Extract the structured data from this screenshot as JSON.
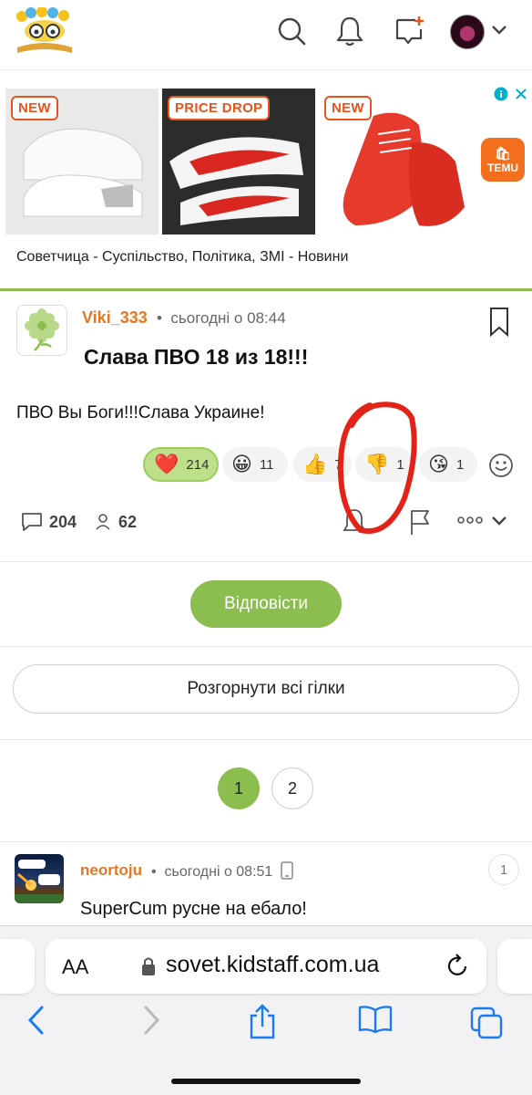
{
  "header": {
    "logo_icon": "owl-book-logo-icon",
    "search_icon": "search-icon",
    "bell_icon": "bell-icon",
    "new_post_icon": "chat-plus-icon",
    "avatar_icon": "user-avatar",
    "menu_icon": "chevron-down-icon"
  },
  "ad": {
    "tiles": [
      {
        "badge": "NEW"
      },
      {
        "badge": "PRICE DROP"
      },
      {
        "badge": "NEW"
      }
    ],
    "brand": "TEMU",
    "caption": "Советчица - Суспільство, Політика, ЗМІ - Новини"
  },
  "post": {
    "author": "Viki_333",
    "time": "сьогодні о 08:44",
    "title": "Слава ПВО 18 из 18!!!",
    "body": "ПВО Вы Боги!!!Слава Украине!",
    "reactions": [
      {
        "emoji": "❤️",
        "count": "214"
      },
      {
        "emoji": "😀",
        "count": "11"
      },
      {
        "emoji": "👍",
        "count": "7"
      },
      {
        "emoji": "👎",
        "count": "1"
      },
      {
        "emoji": "😘",
        "count": "1"
      }
    ],
    "comments_count": "204",
    "viewers_count": "62"
  },
  "reply_label": "Відповісти",
  "expand_label": "Розгорнути всі гілки",
  "pagination": [
    "1",
    "2"
  ],
  "comment": {
    "author": "neortoju",
    "time": "сьогодні о 08:51",
    "number": "1",
    "body": "SuperCum русне на ебало!"
  },
  "browser": {
    "aa_label": "AA",
    "url": "sovet.kidstaff.com.ua"
  },
  "colors": {
    "accent_green": "#8cbd4f",
    "author_orange": "#e37722",
    "badge_orange": "#e8541a",
    "ios_blue": "#1a7cf5"
  }
}
